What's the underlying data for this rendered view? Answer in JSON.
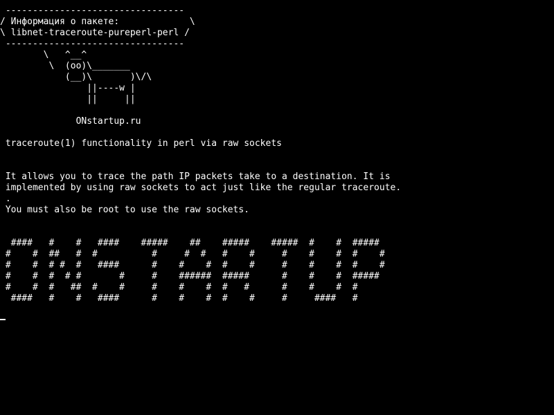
{
  "colors": {
    "background": "#000000",
    "foreground": "#ffffff"
  },
  "terminal": {
    "banner": {
      "border_top": " ---------------------------------",
      "title_line": "/ Информация о пакете:             \\",
      "package_line": "\\ libnet-traceroute-pureperl-perl /",
      "border_bottom": " ---------------------------------"
    },
    "cow": [
      "        \\   ^__^",
      "         \\  (oo)\\_______",
      "            (__)\\       )\\/\\",
      "                ||----w |",
      "                ||     ||"
    ],
    "site_label": "              ONstartup.ru",
    "summary": " traceroute(1) functionality in perl via raw sockets",
    "description": [
      " It allows you to trace the path IP packets take to a destination. It is",
      " implemented by using raw sockets to act just like the regular traceroute.",
      " .",
      " You must also be root to use the raw sockets."
    ],
    "ascii_art": [
      "  ####   #    #   ####    #####    ##    #####    #####  #    #  #####",
      " #    #  ##   #  #          #     #  #   #    #     #    #    #  #    #",
      " #    #  # #  #   ####      #    #    #  #    #     #    #    #  #    #",
      " #    #  #  # #       #     #    ######  #####      #    #    #  #####",
      " #    #  #   ##  #    #     #    #    #  #   #      #    #    #  #",
      "  ####   #    #   ####      #    #    #  #    #     #     ####   #"
    ]
  }
}
